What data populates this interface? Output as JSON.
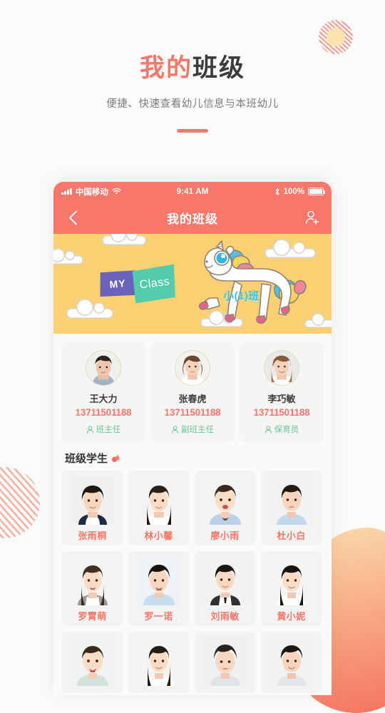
{
  "hero": {
    "title_accent": "我的",
    "title_dark": "班级",
    "subtitle": "便捷、快速查看幼儿信息与本班幼儿"
  },
  "colors": {
    "accent": "#f7776a",
    "banner_bg": "#fbd072",
    "role_green": "#64c59c",
    "class_label": "#34c6ef",
    "page_bg": "#fbfbfa"
  },
  "phone": {
    "statusbar": {
      "carrier": "中国移动",
      "time": "9:41 AM",
      "battery": "100%",
      "signal_icon": "signal-bars-icon",
      "wifi_icon": "wifi-icon",
      "bluetooth_icon": "bluetooth-icon",
      "battery_icon": "battery-icon"
    },
    "navbar": {
      "back_icon": "chevron-left-icon",
      "title": "我的班级",
      "add_icon": "add-person-icon"
    },
    "banner": {
      "tag_my": "MY",
      "tag_class": "Class",
      "class_label": "小(1)班",
      "mascot_icon": "unicorn-icon"
    },
    "teachers": [
      {
        "name": "王大力",
        "phone": "13711501188",
        "role": "班主任",
        "role_icon": "person-icon",
        "avatar": "male-teacher-avatar"
      },
      {
        "name": "张春虎",
        "phone": "13711501188",
        "role": "副班主任",
        "role_icon": "person-icon",
        "avatar": "female-teacher-avatar-1"
      },
      {
        "name": "李巧敏",
        "phone": "13711501188",
        "role": "保育员",
        "role_icon": "person-icon",
        "avatar": "female-teacher-avatar-2"
      }
    ],
    "students_section": {
      "title": "班级学生",
      "decoration_icon": "apple-icon"
    },
    "students": [
      {
        "name": "张雨桐",
        "photo": "student-photo-1"
      },
      {
        "name": "林小馨",
        "photo": "student-photo-2"
      },
      {
        "name": "廖小雨",
        "photo": "student-photo-3"
      },
      {
        "name": "杜小白",
        "photo": "student-photo-4"
      },
      {
        "name": "罗霄萌",
        "photo": "student-photo-5"
      },
      {
        "name": "罗一诺",
        "photo": "student-photo-6"
      },
      {
        "name": "刘雨敏",
        "photo": "student-photo-7"
      },
      {
        "name": "黄小妮",
        "photo": "student-photo-8"
      },
      {
        "name": "",
        "photo": "student-photo-9"
      },
      {
        "name": "",
        "photo": "student-photo-10"
      },
      {
        "name": "",
        "photo": "student-photo-11"
      },
      {
        "name": "",
        "photo": "student-photo-12"
      }
    ]
  },
  "decorations": {
    "sun_icon": "striped-sun-icon",
    "left_circle_icon": "striped-circle-icon",
    "corner_blob_icon": "gradient-blob-icon"
  }
}
